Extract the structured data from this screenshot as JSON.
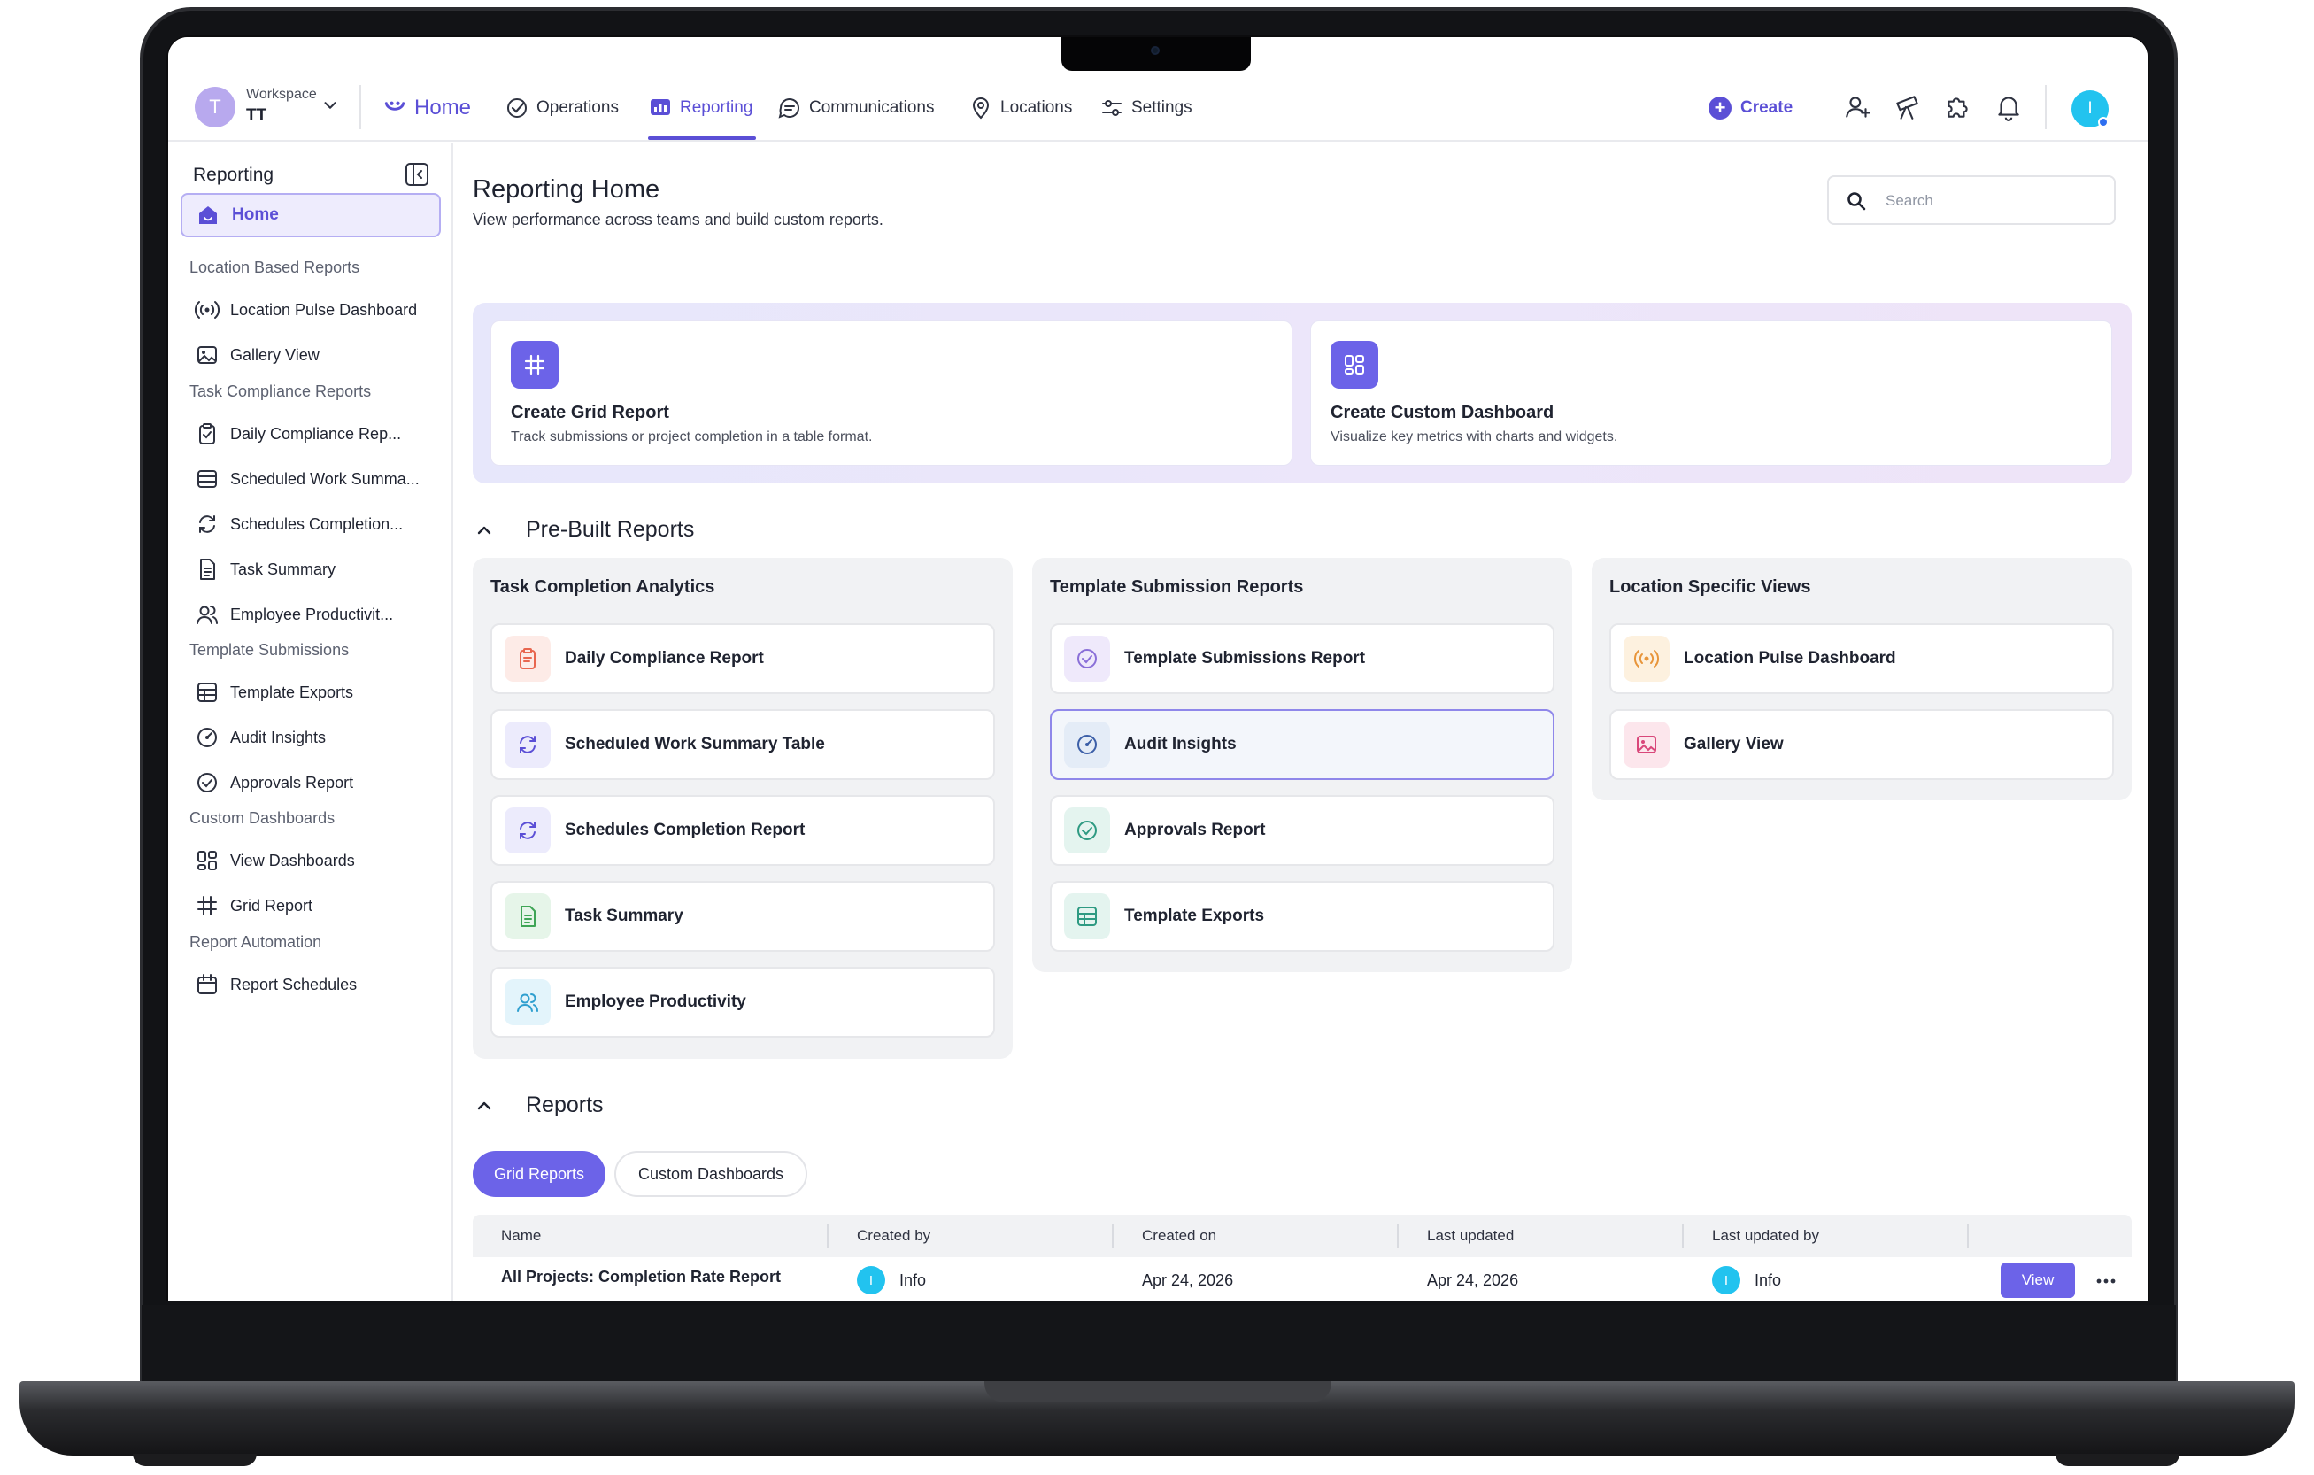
{
  "workspace": {
    "avatar_letter": "T",
    "label": "Workspace",
    "name": "TT"
  },
  "nav": {
    "home": "Home",
    "operations": "Operations",
    "reporting": "Reporting",
    "communications": "Communications",
    "locations": "Locations",
    "settings": "Settings",
    "create": "Create",
    "user_initial": "I"
  },
  "sidebar": {
    "title": "Reporting",
    "home": "Home",
    "sections": [
      {
        "label": "Location Based Reports",
        "items": [
          "Location Pulse Dashboard",
          "Gallery View"
        ]
      },
      {
        "label": "Task Compliance Reports",
        "items": [
          "Daily Compliance Rep...",
          "Scheduled Work Summa...",
          "Schedules Completion...",
          "Task Summary",
          "Employee Productivit..."
        ]
      },
      {
        "label": "Template Submissions",
        "items": [
          "Template Exports",
          "Audit Insights",
          "Approvals Report"
        ]
      },
      {
        "label": "Custom Dashboards",
        "items": [
          "View Dashboards",
          "Grid Report"
        ]
      },
      {
        "label": "Report Automation",
        "items": [
          "Report Schedules"
        ]
      }
    ]
  },
  "page": {
    "title": "Reporting Home",
    "subtitle": "View performance across teams and build custom reports.",
    "search_placeholder": "Search"
  },
  "create_cards": [
    {
      "title": "Create Grid Report",
      "desc": "Track submissions or project completion in a table format.",
      "icon": "grid-hash-icon"
    },
    {
      "title": "Create Custom Dashboard",
      "desc": "Visualize key metrics with charts and widgets.",
      "icon": "dashboard-icon"
    }
  ],
  "prebuilt": {
    "heading": "Pre-Built Reports",
    "groups": [
      {
        "title": "Task Completion Analytics",
        "items": [
          "Daily Compliance Report",
          "Scheduled Work Summary Table",
          "Schedules Completion Report",
          "Task Summary",
          "Employee Productivity"
        ]
      },
      {
        "title": "Template Submission Reports",
        "items": [
          "Template Submissions Report",
          "Audit Insights",
          "Approvals Report",
          "Template Exports"
        ]
      },
      {
        "title": "Location Specific Views",
        "items": [
          "Location Pulse Dashboard",
          "Gallery View"
        ]
      }
    ]
  },
  "reports": {
    "heading": "Reports",
    "tabs": [
      "Grid Reports",
      "Custom Dashboards"
    ],
    "columns": [
      "Name",
      "Created by",
      "Created on",
      "Last updated",
      "Last updated by"
    ],
    "rows": [
      {
        "name": "All Projects: Completion Rate Report",
        "created_by_initial": "I",
        "created_by": "Info",
        "created_on": "Apr 24, 2026",
        "last_updated": "Apr 24, 2026",
        "last_updated_by_initial": "I",
        "last_updated_by": "Info",
        "action": "View"
      }
    ]
  },
  "colors": {
    "accent": "#5b4fd6",
    "button": "#6c63e8",
    "avatar": "#22c3ef"
  }
}
